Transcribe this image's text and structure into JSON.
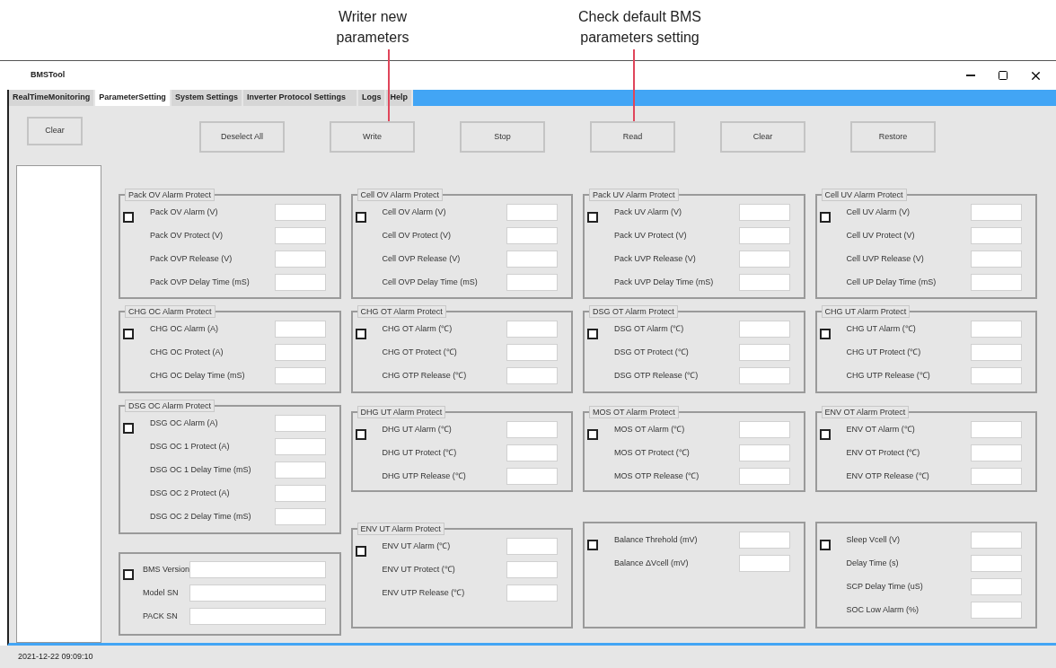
{
  "annotations": [
    {
      "text": "Writer new parameters"
    },
    {
      "text": "Check default BMS parameters setting"
    }
  ],
  "window": {
    "title": "BMSTool"
  },
  "tabs": [
    {
      "label": "RealTimeMonitoring",
      "selected": false
    },
    {
      "label": "ParameterSetting",
      "selected": true
    },
    {
      "label": "System Settings",
      "selected": false
    },
    {
      "label": "Inverter Protocol Settings",
      "selected": false
    },
    {
      "label": "Logs",
      "selected": false
    },
    {
      "label": "Help",
      "selected": false
    }
  ],
  "sidebar": {
    "clear_button": "Clear"
  },
  "toolbar": [
    "Deselect All",
    "Write",
    "Stop",
    "Read",
    "Clear",
    "Restore"
  ],
  "columns": [
    [
      {
        "kind": "group",
        "title": "Pack OV Alarm Protect",
        "checked": false,
        "fields": [
          "Pack OV Alarm (V)",
          "Pack OV Protect (V)",
          "Pack OVP Release (V)",
          "Pack OVP Delay Time (mS)"
        ]
      },
      {
        "kind": "group",
        "title": "CHG OC Alarm Protect",
        "checked": false,
        "fields": [
          "CHG OC Alarm (A)",
          "CHG OC Protect (A)",
          "CHG OC Delay Time (mS)"
        ]
      },
      {
        "kind": "group",
        "title": "DSG OC  Alarm Protect",
        "checked": false,
        "fields": [
          "DSG OC Alarm (A)",
          "DSG OC 1 Protect (A)",
          "DSG OC 1 Delay Time (mS)",
          "DSG OC 2 Protect (A)",
          "DSG OC 2 Delay Time (mS)"
        ]
      },
      {
        "kind": "wide",
        "checked": false,
        "fields": [
          "BMS Version",
          "Model SN",
          "PACK SN"
        ]
      }
    ],
    [
      {
        "kind": "group",
        "title": "Cell OV Alarm Protect",
        "checked": false,
        "fields": [
          "Cell OV Alarm (V)",
          "Cell OV Protect (V)",
          "Cell OVP Release (V)",
          "Cell OVP Delay Time (mS)"
        ]
      },
      {
        "kind": "group",
        "title": "CHG OT Alarm Protect",
        "checked": false,
        "fields": [
          "CHG OT Alarm (℃)",
          "CHG OT Protect (℃)",
          "CHG OTP Release (℃)"
        ]
      },
      {
        "kind": "group",
        "title": "DHG UT Alarm Protect",
        "checked": false,
        "fields": [
          "DHG UT Alarm (℃)",
          "DHG UT Protect (℃)",
          "DHG UTP Release (℃)"
        ]
      },
      {
        "kind": "group",
        "title": "ENV UT Alarm Protect",
        "checked": false,
        "fields": [
          "ENV UT Alarm (℃)",
          "ENV UT Protect (℃)",
          "ENV UTP Release (℃)"
        ]
      }
    ],
    [
      {
        "kind": "group",
        "title": "Pack UV Alarm Protect",
        "checked": false,
        "fields": [
          "Pack UV Alarm (V)",
          "Pack UV Protect (V)",
          "Pack UVP Release (V)",
          "Pack UVP Delay Time (mS)"
        ]
      },
      {
        "kind": "group",
        "title": "DSG OT Alarm Protect",
        "checked": false,
        "fields": [
          "DSG OT Alarm (℃)",
          "DSG OT Protect (℃)",
          "DSG OTP Release (℃)"
        ]
      },
      {
        "kind": "group",
        "title": "MOS OT Alarm Protect",
        "checked": false,
        "fields": [
          "MOS OT Alarm (℃)",
          "MOS OT Protect (℃)",
          "MOS OTP Release (℃)"
        ]
      },
      {
        "kind": "group",
        "checked": false,
        "fields": [
          "Balance Threhold (mV)",
          "Balance  ΔVcell (mV)"
        ]
      }
    ],
    [
      {
        "kind": "group",
        "title": "Cell UV Alarm Protect",
        "checked": false,
        "fields": [
          "Cell UV Alarm (V)",
          "Cell UV Protect (V)",
          "Cell UVP Release (V)",
          "Cell UP Delay Time (mS)"
        ]
      },
      {
        "kind": "group",
        "title": "CHG UT Alarm Protect",
        "checked": false,
        "fields": [
          "CHG UT Alarm (℃)",
          "CHG UT Protect (℃)",
          "CHG UTP Release (℃)"
        ]
      },
      {
        "kind": "group",
        "title": "ENV OT Alarm Protect",
        "checked": false,
        "fields": [
          "ENV OT Alarm (℃)",
          "ENV OT Protect (℃)",
          "ENV OTP Release (℃)"
        ]
      },
      {
        "kind": "group",
        "checked": false,
        "fields": [
          "Sleep Vcell  (V)",
          "Delay  Time  (s)",
          "SCP Delay Time  (uS)",
          "SOC Low  Alarm (%)"
        ]
      }
    ]
  ],
  "status_bar": "2021-12-22 09:09:10"
}
